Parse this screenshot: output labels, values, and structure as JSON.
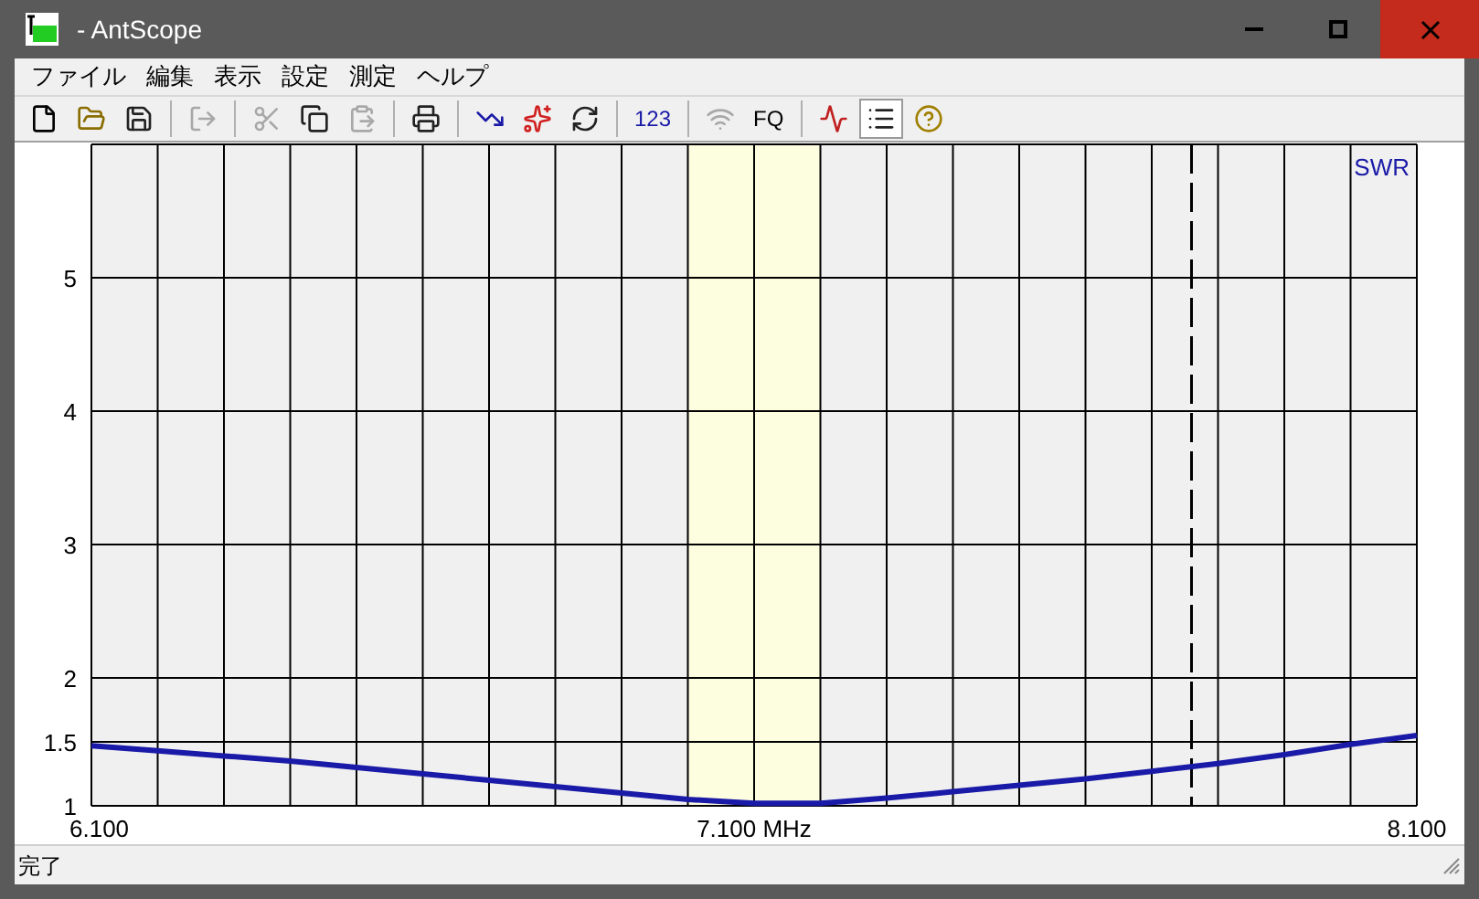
{
  "window": {
    "title": "- AntScope"
  },
  "menu": [
    "ファイル",
    "編集",
    "表示",
    "設定",
    "測定",
    "ヘルプ"
  ],
  "toolbar": [
    {
      "kind": "icon",
      "disabled": false,
      "pressed": false
    },
    {
      "kind": "icon",
      "disabled": false,
      "pressed": false
    },
    {
      "kind": "icon",
      "disabled": false,
      "pressed": false
    },
    {
      "kind": "separator"
    },
    {
      "kind": "icon",
      "disabled": true,
      "pressed": false
    },
    {
      "kind": "separator"
    },
    {
      "kind": "icon",
      "disabled": true,
      "pressed": false
    },
    {
      "kind": "icon",
      "disabled": false,
      "pressed": false
    },
    {
      "kind": "icon",
      "disabled": true,
      "pressed": false
    },
    {
      "kind": "separator"
    },
    {
      "kind": "icon",
      "disabled": false,
      "pressed": false
    },
    {
      "kind": "separator"
    },
    {
      "kind": "icon",
      "disabled": false,
      "pressed": false
    },
    {
      "kind": "icon",
      "disabled": false,
      "pressed": false
    },
    {
      "kind": "icon",
      "disabled": false,
      "pressed": false
    },
    {
      "kind": "separator"
    },
    {
      "kind": "text",
      "label": "123",
      "disabled": false,
      "pressed": false
    },
    {
      "kind": "separator"
    },
    {
      "kind": "icon",
      "disabled": true,
      "pressed": false
    },
    {
      "kind": "text",
      "label": "FQ",
      "disabled": false,
      "pressed": false
    },
    {
      "kind": "separator"
    },
    {
      "kind": "icon",
      "disabled": false,
      "pressed": false
    },
    {
      "kind": "icon",
      "disabled": false,
      "pressed": true
    },
    {
      "kind": "icon",
      "disabled": false,
      "pressed": false
    }
  ],
  "chart": {
    "chart_data": {
      "type": "line",
      "grid": true,
      "x": [
        6.1,
        6.2,
        6.3,
        6.4,
        6.5,
        6.6,
        6.7,
        6.8,
        6.9,
        7.0,
        7.1,
        7.2,
        7.3,
        7.4,
        7.5,
        7.6,
        7.7,
        7.8,
        7.9,
        8.0,
        8.1
      ],
      "series": [
        {
          "name": "SWR",
          "color": "#1a1aa8",
          "values": [
            1.47,
            1.43,
            1.39,
            1.35,
            1.3,
            1.25,
            1.2,
            1.15,
            1.1,
            1.05,
            1.02,
            1.02,
            1.06,
            1.11,
            1.16,
            1.21,
            1.27,
            1.33,
            1.4,
            1.48,
            1.55
          ]
        }
      ],
      "xlim": [
        6.1,
        8.1
      ],
      "ylim": [
        1,
        6
      ],
      "xticks": [
        {
          "value": 6.1,
          "label": "6.100"
        },
        {
          "value": 7.1,
          "label": "7.100 MHz"
        },
        {
          "value": 8.1,
          "label": "8.100"
        }
      ],
      "yticks": [
        {
          "value": 1,
          "label": "1"
        },
        {
          "value": 1.5,
          "label": "1.5"
        },
        {
          "value": 2,
          "label": "2"
        },
        {
          "value": 3,
          "label": "3"
        },
        {
          "value": 4,
          "label": "4"
        },
        {
          "value": 5,
          "label": "5"
        }
      ],
      "bands": [
        {
          "axis": "x",
          "from": 7.0,
          "to": 7.2,
          "color": "#fdfde0"
        }
      ],
      "ref_lines": [
        {
          "axis": "x",
          "value": 7.76
        }
      ]
    }
  },
  "status_bar": "完了"
}
